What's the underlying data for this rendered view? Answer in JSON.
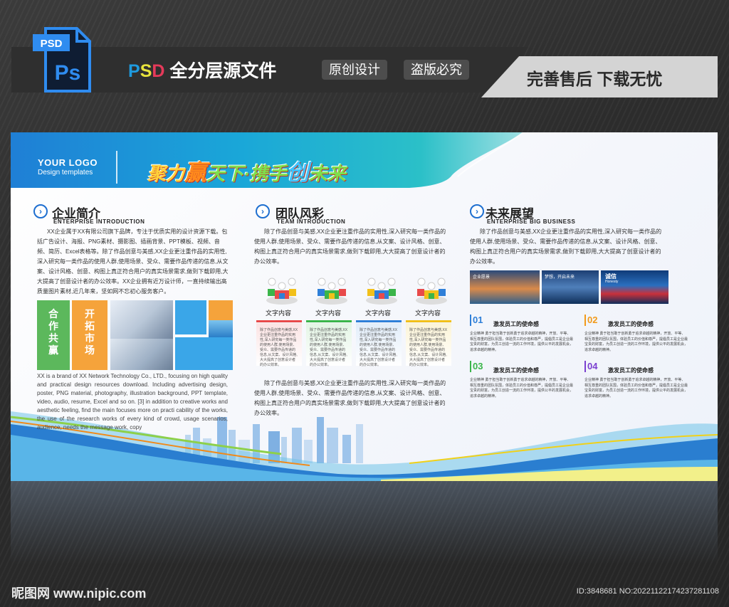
{
  "banner": {
    "psd_badge": "PSD",
    "ps_icon": "Ps",
    "title_psd_p": "P",
    "title_psd_s": "S",
    "title_psd_d": "D",
    "title_rest": " 全分层源文件",
    "tag1": "原创设计",
    "tag2": "盗版必究",
    "after_sale": "完善售后 下载无忧"
  },
  "board": {
    "logo_line1": "YOUR LOGO",
    "logo_line2": "Design templates",
    "slogan": {
      "p1": "聚力",
      "p2": "赢",
      "p3": "天下·",
      "p4": "携手",
      "p5": "创",
      "p6": "未来"
    },
    "enterprise": {
      "title": "企业简介",
      "subtitle": "ENTERPRISE INTRODUCTION",
      "paragraph": "XX企业属于XX有限公司旗下品牌，专注于优质实用的设计资源下载。包括广告设计、海报、PNG素材、摄影图、插画背景、PPT模板、视频、音频、简历、Excel表格等。除了作品创意与美感,XX企业更注重作品的实用性,深入研究每一类作品的使用人群,使用场景、受众、需要作品传递的信息,从文案、设计风格、创意、构图上真正符合用户的真实场景需求,做到下载即用,大大提高了创意设计者的办公效率。XX企业拥有近万设计师，一直持续输出高质量图片素材,近几年来，坚如网不忘初心服务客户。",
      "tile1": "合作共赢",
      "tile2": "开拓市场",
      "english": "XX is a brand of XX Network Technology Co., LTD., focusing on high quality and practical design resources download. Including advertising design, poster, PNG material, photography, illustration background, PPT template, video, audio, resume, Excel and so on. [3] in addition to creative works and aesthetic feeling, find the main focuses more on practi cability of the works, the use of the research works of every kind of crowd, usage scenarios, audience, needs the message work, copy"
    },
    "team": {
      "title": "团队风彩",
      "subtitle": "TEAM INTRODUCTION",
      "paragraph1": "除了作品创意与美感,XX企业更注重作品的实用性,深入研究每一类作品的使用人群,使用场景、受众、需要作品传递的信息,从文案、设计风格、创意、构图上真正符合用户的真实场景需求,做到下载即用,大大提高了创意设计者的办公效率。",
      "items": [
        {
          "label": "文字内容",
          "color": "#e84a4a"
        },
        {
          "label": "文字内容",
          "color": "#3bb54a"
        },
        {
          "label": "文字内容",
          "color": "#2f7fd8"
        },
        {
          "label": "文字内容",
          "color": "#f2c01a"
        }
      ],
      "card_text": "除了作品创意与美感,XX企业更注重作品的实用性,深入研究每一类作品的使用人群,使用场景、受众、需要作品传递的信息,从文案、设计风格,大大提高了创意设计者的办公效率。",
      "paragraph2": "除了作品创意与美感,XX企业更注重作品的实用性,深入研究每一类作品的使用人群,使用场景、受众、需要作品传递的信息,从文案、设计风格、创意、构图上真正符合用户的真实场景需求,做到下载即用,大大提高了创意设计者的办公效率。"
    },
    "future": {
      "title": "未来展望",
      "subtitle": "ENTERPRISE BIG BUSINESS",
      "paragraph": "除了作品创意与美感,XX企业更注重作品的实用性,深入研究每一类作品的使用人群,使用场景、受众、需要作品传递的信息,从文案、设计风格、创意、构图上真正符合用户的真实场景需求,做到下载即用,大大提高了创意设计者的办公效率。",
      "photo1_caption": "企业愿景",
      "photo2_caption": "梦想，开启未来",
      "photo3_caption": "诚信",
      "photo3_sub": "Honesty",
      "items": [
        {
          "num": "01",
          "title": "激发员工的使命感",
          "color": "#2f7fd8"
        },
        {
          "num": "02",
          "title": "激发员工的使命感",
          "color": "#f29a1a"
        },
        {
          "num": "03",
          "title": "激发员工的使命感",
          "color": "#3bb54a"
        },
        {
          "num": "04",
          "title": "激发员工的使命感",
          "color": "#7a3fd0"
        }
      ],
      "item_text": "企业精神 勇于担当敢于创新勇于追求卓越的精神，开放、平等、相互尊重的团队氛围，体验员工的价值和尊严，提倡员工是企业最宝贵的财富，为员工创造一流的工作环境，提供公平的发展机会，追求卓越的精神。"
    }
  },
  "watermark": {
    "site": "昵图网 www.nipic.com",
    "id": "ID:3848681 NO:20221122174237281108"
  }
}
